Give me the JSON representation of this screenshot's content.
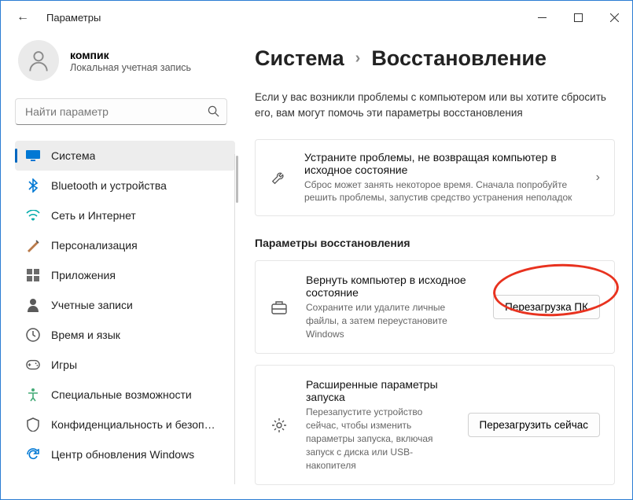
{
  "titlebar": {
    "title": "Параметры"
  },
  "profile": {
    "name": "компик",
    "account": "Локальная учетная запись"
  },
  "search": {
    "placeholder": "Найти параметр"
  },
  "nav": [
    {
      "label": "Система",
      "icon": "system",
      "active": true
    },
    {
      "label": "Bluetooth и устройства",
      "icon": "bluetooth"
    },
    {
      "label": "Сеть и Интернет",
      "icon": "network"
    },
    {
      "label": "Персонализация",
      "icon": "personalization"
    },
    {
      "label": "Приложения",
      "icon": "apps"
    },
    {
      "label": "Учетные записи",
      "icon": "accounts"
    },
    {
      "label": "Время и язык",
      "icon": "time"
    },
    {
      "label": "Игры",
      "icon": "gaming"
    },
    {
      "label": "Специальные возможности",
      "icon": "accessibility"
    },
    {
      "label": "Конфиденциальность и безопасность",
      "icon": "privacy"
    },
    {
      "label": "Центр обновления Windows",
      "icon": "update"
    }
  ],
  "breadcrumb": {
    "parent": "Система",
    "current": "Восстановление"
  },
  "description": "Если у вас возникли проблемы с компьютером или вы хотите сбросить его, вам могут помочь эти параметры восстановления",
  "tips_card": {
    "title": "Устраните проблемы, не возвращая компьютер в исходное состояние",
    "desc": "Сброс может занять некоторое время. Сначала попробуйте решить проблемы, запустив средство устранения неполадок"
  },
  "section_title": "Параметры восстановления",
  "options": [
    {
      "title": "Вернуть компьютер в исходное состояние",
      "desc": "Сохраните или удалите личные файлы, а затем переустановите Windows",
      "button": "Перезагрузка ПК",
      "highlighted": true
    },
    {
      "title": "Расширенные параметры запуска",
      "desc": "Перезапустите устройство сейчас, чтобы изменить параметры запуска, включая запуск с диска или USB-накопителя",
      "button": "Перезагрузить сейчас"
    }
  ]
}
